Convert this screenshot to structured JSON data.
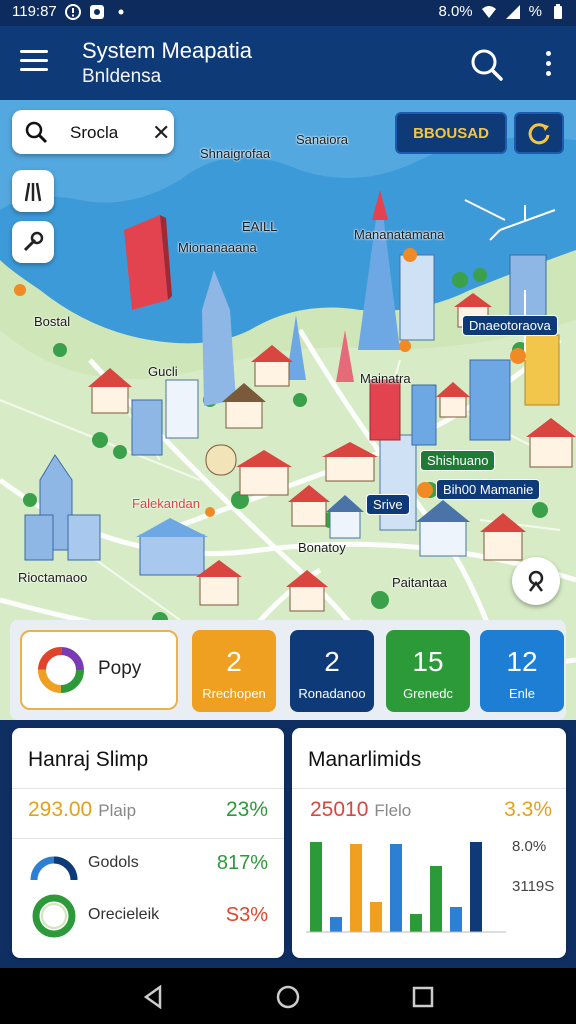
{
  "status": {
    "time": "119:87",
    "right_text": "8.0%",
    "battery": "%"
  },
  "appbar": {
    "title": "System Meapatia",
    "subtitle": "Bnldensa"
  },
  "search": {
    "value": "Srocla"
  },
  "buttons": {
    "broad": "BBOUSAD"
  },
  "map_labels": {
    "sanaiora": "Sanaiora",
    "shnaigrofaa": "Shnaigrofaa",
    "eaill": "EAILL",
    "mionanaaana": "Mionanaaana",
    "manamtamana": "Mananatamana",
    "dostal": "Bostal",
    "gucli": "Gucli",
    "mainatra": "Mainatra",
    "falakan": "Falekandan",
    "bonatoy": "Bonatoy",
    "ratantaa": "Paitantaa",
    "riocamonao": "Rioctamaoo"
  },
  "map_tags": {
    "dnaenor": "Dnaeotoraova",
    "shishuano": "Shishuano",
    "bihuo": "Bih00 Mamanie",
    "srive": "Srive"
  },
  "kpis": {
    "main": {
      "label": "Popy"
    },
    "items": [
      {
        "value": "2",
        "caption": "Rrechopen",
        "color": "#f0a020"
      },
      {
        "value": "2",
        "caption": "Ronadanoo",
        "color": "#0f3a78"
      },
      {
        "value": "15",
        "caption": "Grenedc",
        "color": "#2d9a3a"
      },
      {
        "value": "12",
        "caption": "Enle",
        "color": "#1d7ed4"
      }
    ]
  },
  "card_left": {
    "title": "Hanraj Slimp",
    "amount": "293.00",
    "amount_sub": "Plaip",
    "pct": "23%",
    "rows": [
      {
        "label": "Godols",
        "pct": "817%",
        "pct_color": "#2d9a3a"
      },
      {
        "label": "Orecieleik",
        "pct": "S3%",
        "pct_color": "#e0452b"
      }
    ]
  },
  "card_right": {
    "title": "Manarlimids",
    "amount": "25010",
    "amount_sub": "Flelo",
    "pct": "3.3%",
    "side_values": [
      "8.0%",
      "3119S"
    ]
  },
  "chart_data": {
    "type": "bar",
    "series": [
      {
        "values": [
          90,
          15,
          88,
          30,
          88,
          18,
          66,
          25,
          90
        ],
        "colors": [
          "#2d9a3a",
          "#2d7fd4",
          "#f0a020",
          "#f0a020",
          "#2d7fd4",
          "#2d9a3a",
          "#2d9a3a",
          "#2d7fd4",
          "#0f3a78"
        ]
      }
    ],
    "ylim": [
      0,
      100
    ]
  }
}
